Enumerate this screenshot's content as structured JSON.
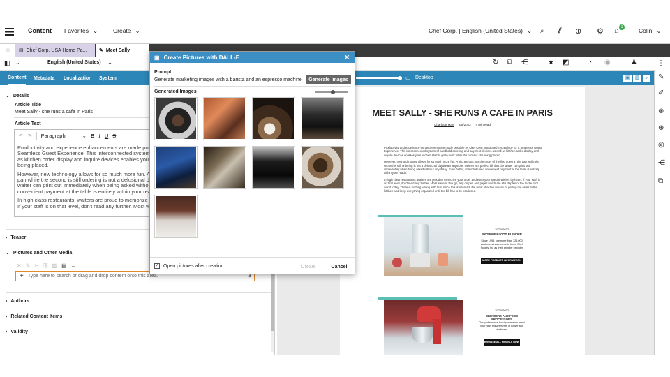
{
  "topbar": {
    "title": "Content",
    "favorites": "Favorites",
    "create": "Create",
    "site_locale": "Chef Corp. | English (United States)",
    "user": "Colin",
    "notification_count": "1"
  },
  "tabs": [
    {
      "label": "Chef Corp. USA Home Pa..."
    },
    {
      "label": "Meet Sally"
    }
  ],
  "locale_select": "English (United States)",
  "form_tabs": [
    "Content",
    "Metadata",
    "Localization",
    "System"
  ],
  "device_label": "Desktop",
  "form": {
    "details_heading": "Details",
    "article_title_label": "Article Title",
    "article_title_value": "Meet Sally - she runs a cafe in Paris",
    "article_text_label": "Article Text",
    "paragraph_style": "Paragraph",
    "body": [
      "Productivity and experience enhancements are made possible by Chef Corp. Integrated Technology for a Seamless Guest Experience. This interconnected system of handheld ordering and payment devices as well as kitchen order display and inquire devices enables your kitchen staff to go to work while the order is still being placed.",
      "However, new technology allows for so much more fun. A kitchen that has the order of the first guest in the pan while the second is still ordering is not a delusional daydream anymore. Neither is a perfect bill that the waiter can print out immediately when being asked without any delay. Even better, immediate and convenient payment at the table is entirely within your reach.",
      "In high class restaurants, waiters are proud to memorize your order and even your special wishes by heart. If your staff is on that level, don't read any further. Most waiters, though, rely on pen and paper which are still"
    ],
    "teaser": "Teaser",
    "pictures_media": "Pictures and Other Media",
    "dropzone_placeholder": "Type here to search or drag and drop content onto this area.",
    "authors": "Authors",
    "related": "Related Content Items",
    "validity": "Validity"
  },
  "modal": {
    "title": "Create Pictures with DALL-E",
    "prompt_label": "Prompt",
    "prompt_value": "Generate marketing images with a barista and an espresso machine",
    "generate_button": "Generate Images",
    "generated_label": "Generated Images",
    "slider_value": 0.55,
    "checkbox_label": "Open pictures after creation",
    "checkbox_checked": true,
    "create_button": "Create",
    "cancel_button": "Cancel",
    "images": [
      "espresso-portafilter",
      "espresso-machine-copper",
      "barista-cup-pour",
      "espresso-machine-dark",
      "blue-espresso-machine",
      "portafilter-tamping",
      "barista-black-machine",
      "portafilter-grinder",
      "espresso-machine-brown"
    ]
  },
  "preview": {
    "headline": "MEET SALLY - SHE RUNS A CAFE IN PARIS",
    "author": "Charlotte May",
    "date": "2/9/2023",
    "read_time": "4 min read",
    "paragraphs": [
      "Productivity and experience enhancements are made possible by Chef Corp. Integrated Technology for a Seamless Guest Experience. This interconnected system of handheld ordering and payment devices as well as kitchen order display and inquire devices enables your kitchen staff to go to work while the order is still being placed.",
      "However, new technology allows for so much more fun. A kitchen that has the order of the first guest in the pan while the second is still ordering is not a delusional daydream anymore. Neither is a perfect bill that the waiter can print out immediately when being asked without any delay. Even better, immediate and convenient payment at the table is entirely within your reach.",
      "In high class restaurants, waiters are proud to memorize your order and even your special wishes by heart. If your staff is on that level, don't read any further. Most waiters, though, rely on pen and paper which are still staples of the restaurant world today. There is nothing wrong with that, since this is often still the most effective means of getting the order to the kitchen and keep everything organized until the bill has to be produced."
    ],
    "card1": {
      "date": "10/20/2022",
      "title": "BROWNIE BLOOD BLENDER",
      "text": "Since 1999, our more than 125,000 customers have come to know Chef Supply, Inc as their premier provider",
      "button": "MORE PRODUCT INFORMATION"
    },
    "card2": {
      "date": "10/20/2022",
      "title": "BLENDERS AND FOOD PROCESSORS",
      "text": "Our professional food processors meet your high requirements of power and sturdiness.",
      "button": "BROWSE ALL MODELS NOW"
    }
  },
  "colors": {
    "accent": "#2c87b8",
    "modal_header": "#3b8fc4",
    "tabbar": "#3b3b3b",
    "dropzone_border": "#e08a2a",
    "teal": "#5bbfb3"
  }
}
